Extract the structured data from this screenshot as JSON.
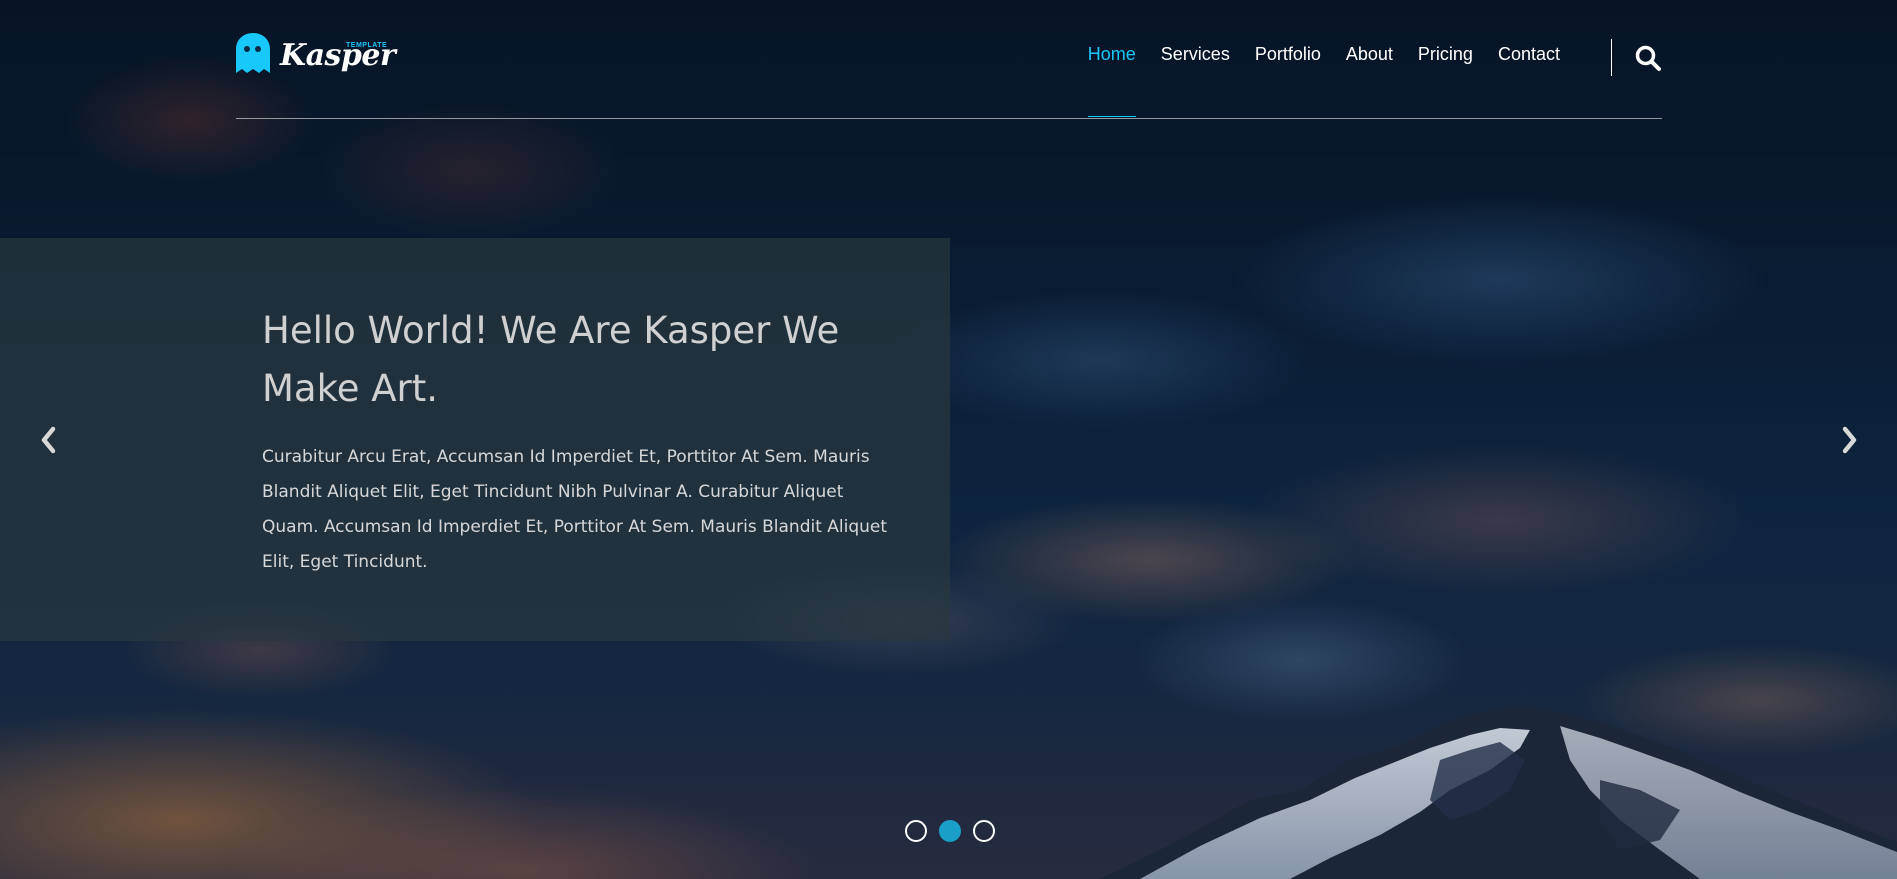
{
  "brand": {
    "name": "Kasper",
    "tag": "TEMPLATE",
    "accent_color": "#19c8fa"
  },
  "nav": {
    "items": [
      {
        "label": "Home",
        "active": true
      },
      {
        "label": "Services",
        "active": false
      },
      {
        "label": "Portfolio",
        "active": false
      },
      {
        "label": "About",
        "active": false
      },
      {
        "label": "Pricing",
        "active": false
      },
      {
        "label": "Contact",
        "active": false
      }
    ],
    "search_icon": "search-icon"
  },
  "slide": {
    "headline": "Hello World! We Are Kasper We Make Art.",
    "body": "Curabitur Arcu Erat, Accumsan Id Imperdiet Et, Porttitor At Sem. Mauris Blandit Aliquet Elit, Eget Tincidunt Nibh Pulvinar A. Curabitur Aliquet Quam. Accumsan Id Imperdiet Et, Porttitor At Sem. Mauris Blandit Aliquet Elit, Eget Tincidunt."
  },
  "carousel": {
    "prev_icon": "chevron-left-icon",
    "next_icon": "chevron-right-icon",
    "slide_count": 3,
    "active_index": 1,
    "dot_active_color": "#1aa0c8"
  }
}
